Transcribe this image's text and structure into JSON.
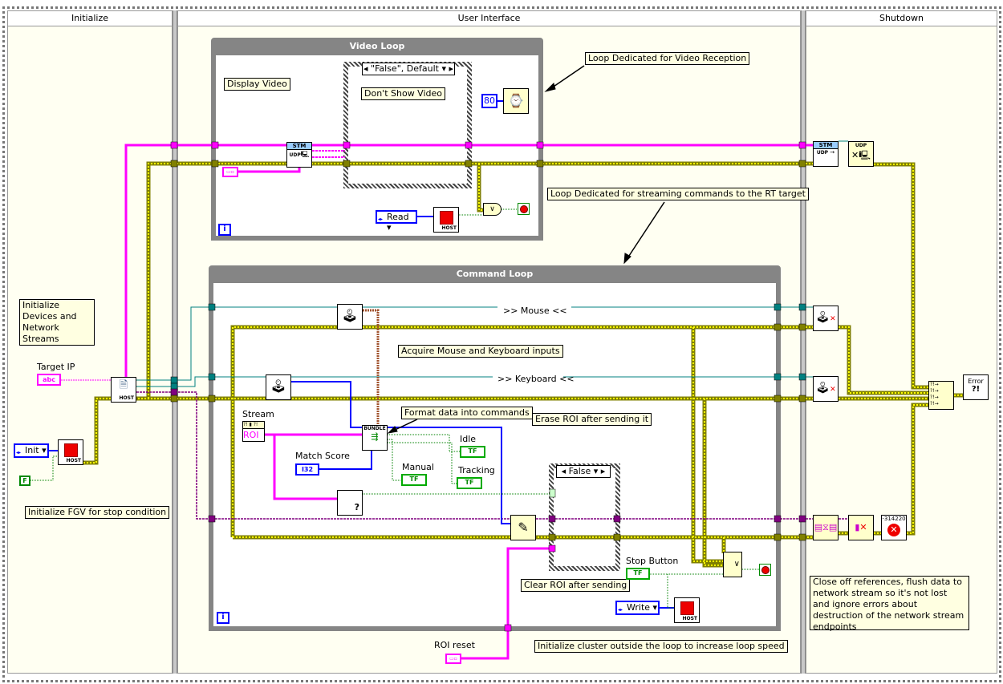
{
  "frames": [
    {
      "title": "Initialize"
    },
    {
      "title": "User Interface"
    },
    {
      "title": "Shutdown"
    }
  ],
  "video_loop": {
    "title": "Video Loop",
    "case_selector": "\"False\", Default",
    "comment_display": "Display Video",
    "comment_case": "Don't Show Video",
    "wait_constant": "80",
    "fgv_mode": "Read ▾",
    "iteration": "i"
  },
  "command_loop": {
    "title": "Command Loop",
    "mouse_label": ">> Mouse <<",
    "keyboard_label": ">> Keyboard <<",
    "comment_acquire": "Acquire Mouse and Keyboard inputs",
    "comment_format": "Format data into commands",
    "comment_erase": "Erase ROI after sending it",
    "comment_clear": "Clear ROI after sending",
    "stream_label": "Stream",
    "stream_control": "ROI",
    "match_score_label": "Match Score",
    "match_score_type": "I32",
    "idle_label": "Idle",
    "manual_label": "Manual",
    "tracking_label": "Tracking",
    "tf": "TF",
    "bundle": "BUNDLE",
    "case_selector": "False",
    "stop_button_label": "Stop Button",
    "fgv_mode": "Write ▾",
    "iteration": "i"
  },
  "initialize": {
    "comment_devices": "Initialize Devices and Network Streams",
    "target_ip_label": "Target IP",
    "target_ip_type": "abc",
    "fgv_mode": "Init ▾",
    "false_constant": "F",
    "comment_fgv": "Initialize FGV for stop condition"
  },
  "annotations": {
    "video_reception": "Loop Dedicated for Video Reception",
    "streaming_commands": "Loop Dedicated for streaming commands to the RT target",
    "roi_reset_label": "ROI reset",
    "init_cluster": "Initialize cluster outside the loop to increase loop speed"
  },
  "shutdown": {
    "error_code": "-314220",
    "error_handler": "Error",
    "comment": "Close off references, flush data to network stream so it's not lost and ignore errors about destruction of the network stream endpoints"
  },
  "node_text": {
    "host": "HOST",
    "stm": "STM",
    "udp": "UDP"
  },
  "colors": {
    "string_wire": "#ff00ff",
    "error_wire": "#808000",
    "refnum_wire": "#008080",
    "numeric_wire": "#0000ff",
    "boolean_wire": "#008000",
    "stream_wire": "#800080",
    "loop_border": "#858585",
    "comment_bg": "#ffffe1"
  }
}
